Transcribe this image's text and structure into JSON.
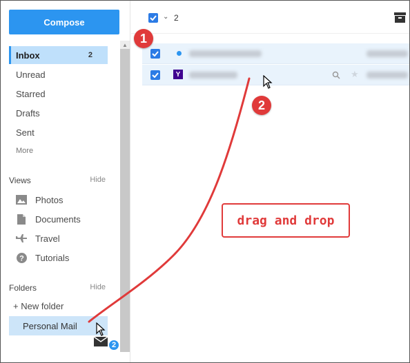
{
  "sidebar": {
    "compose_label": "Compose",
    "items": [
      {
        "label": "Inbox",
        "count": "2"
      },
      {
        "label": "Unread"
      },
      {
        "label": "Starred"
      },
      {
        "label": "Drafts"
      },
      {
        "label": "Sent"
      }
    ],
    "more_label": "More",
    "views": {
      "title": "Views",
      "hide_label": "Hide",
      "items": [
        {
          "label": "Photos",
          "icon": "photo-icon"
        },
        {
          "label": "Documents",
          "icon": "document-icon"
        },
        {
          "label": "Travel",
          "icon": "airplane-icon"
        },
        {
          "label": "Tutorials",
          "icon": "help-icon"
        }
      ]
    },
    "folders": {
      "title": "Folders",
      "hide_label": "Hide",
      "new_folder_label": "+ New folder",
      "personal_mail_label": "Personal Mail"
    }
  },
  "toolbar": {
    "selected_count": "2"
  },
  "drag_badge_count": "2",
  "annotations": {
    "step1": "1",
    "step2": "2",
    "drag_and_drop": "drag and drop",
    "color": "#e03a3a"
  },
  "colors": {
    "accent": "#2c95f0",
    "selected_row": "#e9f3fc",
    "active_nav": "#bfe0fb"
  }
}
